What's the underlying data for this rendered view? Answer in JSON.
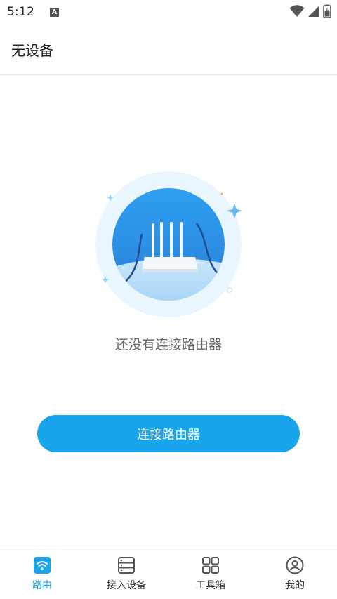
{
  "status_bar": {
    "time": "5:12",
    "notification_icon_letter": "A",
    "icons": [
      "wifi-icon",
      "signal-icon",
      "battery-icon"
    ]
  },
  "app_bar": {
    "title": "无设备"
  },
  "empty_state": {
    "message": "还没有连接路由器",
    "illustration": "router-icon"
  },
  "actions": {
    "connect_button": "连接路由器"
  },
  "colors": {
    "accent": "#19a5ec",
    "text_secondary": "#666666"
  },
  "bottom_nav": {
    "items": [
      {
        "label": "路由",
        "icon": "router-wifi-icon",
        "active": true
      },
      {
        "label": "接入设备",
        "icon": "device-list-icon",
        "active": false
      },
      {
        "label": "工具箱",
        "icon": "grid-icon",
        "active": false
      },
      {
        "label": "我的",
        "icon": "profile-icon",
        "active": false
      }
    ]
  }
}
